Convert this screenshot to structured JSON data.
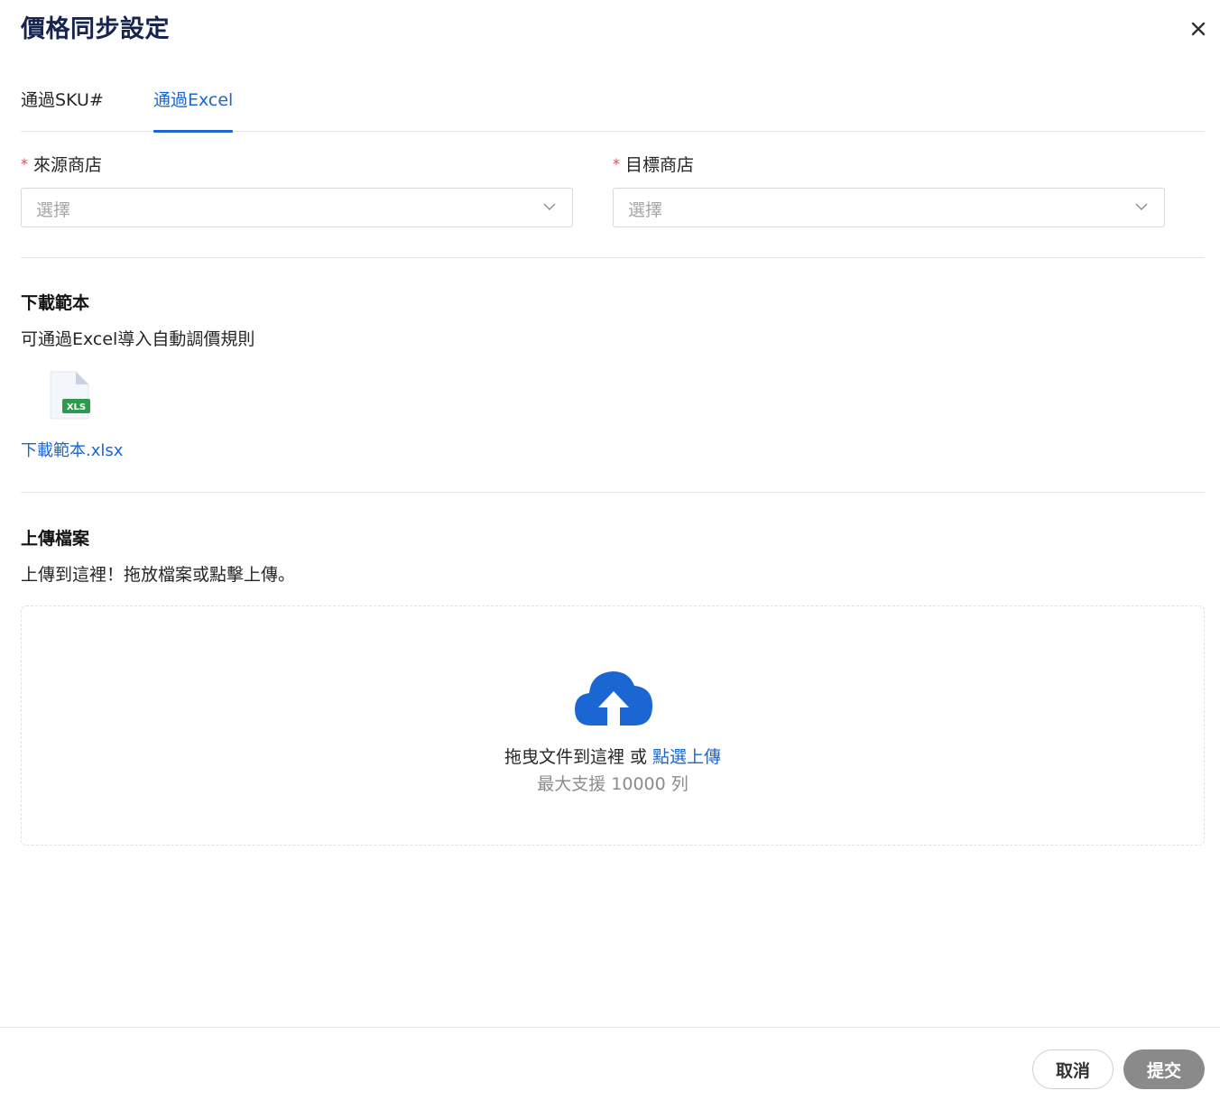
{
  "dialog": {
    "title": "價格同步設定"
  },
  "tabs": [
    {
      "label": "通過SKU#",
      "active": false
    },
    {
      "label": "通過Excel",
      "active": true
    }
  ],
  "form": {
    "source_store": {
      "required_mark": "*",
      "label": "來源商店",
      "placeholder": "選擇"
    },
    "target_store": {
      "required_mark": "*",
      "label": "目標商店",
      "placeholder": "選擇"
    }
  },
  "download": {
    "title": "下載範本",
    "description": "可通過Excel導入自動調價規則",
    "file_badge": "XLS",
    "file_link": "下載範本.xlsx"
  },
  "upload": {
    "title": "上傳檔案",
    "description": "上傳到這裡！拖放檔案或點擊上傳。",
    "drop_text": "拖曳文件到這裡 或 ",
    "drop_link": "點選上傳",
    "limit_text": "最大支援 10000 列"
  },
  "footer": {
    "cancel_label": "取消",
    "submit_label": "提交"
  },
  "colors": {
    "accent": "#1a66d2",
    "title": "#17244d",
    "required": "#e5484d",
    "submit_disabled": "#8a8a8a",
    "excel_green": "#2e9a4f"
  }
}
